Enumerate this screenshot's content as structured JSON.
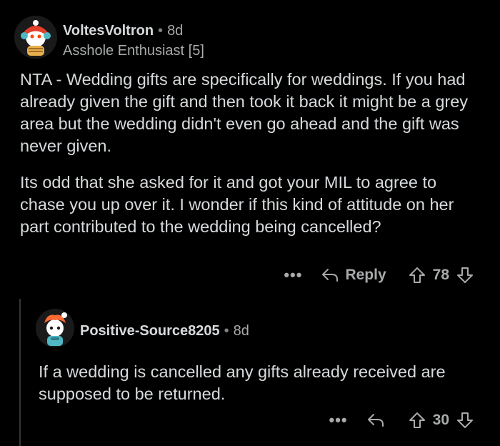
{
  "comments": [
    {
      "username": "VoltesVoltron",
      "age": "8d",
      "flair": "Asshole Enthusiast [5]",
      "paragraphs": [
        "NTA - Wedding gifts are specifically for weddings. If you had already given the gift and then took it back it might be a grey area but the wedding didn't even go ahead and the gift was never given.",
        "Its odd that she asked for it and got your MIL to agree to chase you up over it. I wonder if this kind of attitude on her part contributed to the wedding being cancelled?"
      ],
      "more_label": "•••",
      "reply_label": "Reply",
      "score": "78",
      "avatar_icon": "snoo-avatar-icon"
    },
    {
      "username": "Positive-Source8205",
      "age": "8d",
      "paragraphs": [
        "If a wedding is cancelled any gifts already received are supposed to be returned."
      ],
      "more_label": "•••",
      "score": "30",
      "avatar_icon": "snoo-avatar-icon"
    }
  ],
  "separator": "•",
  "colors": {
    "background": "#000000",
    "text": "#d7dadc",
    "muted": "#a8aaab",
    "thread_line": "#343536",
    "avatar_orange": "#ff6a33",
    "avatar_teal": "#4fb8c4"
  }
}
